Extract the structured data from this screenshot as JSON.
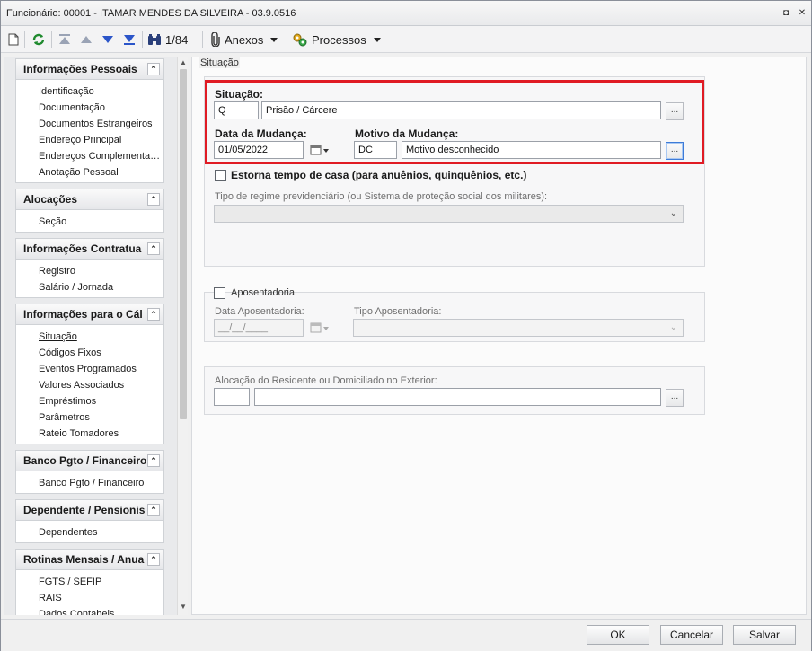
{
  "window": {
    "title": "Funcionário: 00001 - ITAMAR MENDES DA SILVEIRA - 03.9.0516",
    "restore_glyph": "◘",
    "close_glyph": "✕"
  },
  "toolbar": {
    "record_counter": "1/84",
    "anexos_label": "Anexos",
    "processos_label": "Processos"
  },
  "sidebar": {
    "sections": [
      {
        "title": "Informações Pessoais",
        "items": [
          "Identificação",
          "Documentação",
          "Documentos Estrangeiros",
          "Endereço Principal",
          "Endereços Complementa…",
          "Anotação Pessoal"
        ]
      },
      {
        "title": "Alocações",
        "items": [
          "Seção"
        ]
      },
      {
        "title": "Informações Contratua",
        "items": [
          "Registro",
          "Salário / Jornada"
        ]
      },
      {
        "title": "Informações para o Cál",
        "items": [
          "Situação",
          "Códigos Fixos",
          "Eventos Programados",
          "Valores Associados",
          "Empréstimos",
          "Parâmetros",
          "Rateio Tomadores"
        ]
      },
      {
        "title": "Banco Pgto / Financeiro",
        "items": [
          "Banco Pgto / Financeiro"
        ]
      },
      {
        "title": "Dependente / Pensionis",
        "items": [
          "Dependentes"
        ]
      },
      {
        "title": "Rotinas Mensais / Anua",
        "items": [
          "FGTS / SEFIP",
          "RAIS",
          "Dados Contabeis"
        ]
      }
    ],
    "active_item": "Situação"
  },
  "form": {
    "group_title": "Situação",
    "situacao_label": "Situação:",
    "situacao_code": "Q",
    "situacao_desc": "Prisão / Cárcere",
    "data_mudanca_label": "Data da Mudança:",
    "data_mudanca_value": "01/05/2022",
    "motivo_label": "Motivo da Mudança:",
    "motivo_code": "DC",
    "motivo_desc": "Motivo desconhecido",
    "estorna_label": "Estorna tempo de casa (para anuênios, quinquênios, etc.)",
    "regime_label": "Tipo de regime previdenciário (ou Sistema de proteção social dos militares):",
    "regime_value": "",
    "aposentadoria_label": "Aposentadoria",
    "data_apos_label": "Data Aposentadoria:",
    "data_apos_value": "__/__/____",
    "tipo_apos_label": "Tipo Aposentadoria:",
    "alocacao_label": "Alocação do Residente ou Domiciliado no Exterior:",
    "alocacao_code": "",
    "alocacao_desc": "",
    "dots": "..."
  },
  "footer": {
    "ok_label": "OK",
    "cancel_label": "Cancelar",
    "save_label": "Salvar"
  },
  "colors": {
    "highlight_border": "#e01b24",
    "focus_border": "#3d7bd8"
  }
}
